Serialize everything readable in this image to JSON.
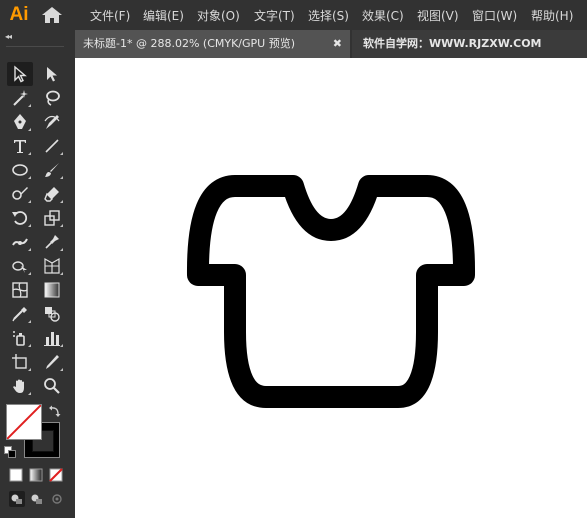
{
  "app": {
    "logo_text": "Ai"
  },
  "menu": {
    "items": [
      {
        "label": "文件(F)"
      },
      {
        "label": "编辑(E)"
      },
      {
        "label": "对象(O)"
      },
      {
        "label": "文字(T)"
      },
      {
        "label": "选择(S)"
      },
      {
        "label": "效果(C)"
      },
      {
        "label": "视图(V)"
      },
      {
        "label": "窗口(W)"
      },
      {
        "label": "帮助(H)"
      }
    ]
  },
  "toolbar": {
    "collapse_label": "◂◂",
    "tools": [
      {
        "icon": "selection-tool-icon"
      },
      {
        "icon": "direct-selection-tool-icon"
      },
      {
        "icon": "magic-wand-tool-icon"
      },
      {
        "icon": "lasso-tool-icon"
      },
      {
        "icon": "pen-tool-icon"
      },
      {
        "icon": "curvature-tool-icon"
      },
      {
        "icon": "type-tool-icon",
        "glyph": "T"
      },
      {
        "icon": "line-segment-tool-icon"
      },
      {
        "icon": "ellipse-tool-icon"
      },
      {
        "icon": "paintbrush-tool-icon"
      },
      {
        "icon": "shaper-tool-icon"
      },
      {
        "icon": "eraser-tool-icon"
      },
      {
        "icon": "rotate-tool-icon"
      },
      {
        "icon": "scale-tool-icon"
      },
      {
        "icon": "width-tool-icon"
      },
      {
        "icon": "puppet-warp-tool-icon"
      },
      {
        "icon": "shape-builder-tool-icon"
      },
      {
        "icon": "perspective-grid-tool-icon"
      },
      {
        "icon": "mesh-tool-icon"
      },
      {
        "icon": "gradient-tool-icon"
      },
      {
        "icon": "eyedropper-tool-icon"
      },
      {
        "icon": "blend-tool-icon"
      },
      {
        "icon": "symbol-sprayer-tool-icon"
      },
      {
        "icon": "column-graph-tool-icon"
      },
      {
        "icon": "artboard-tool-icon"
      },
      {
        "icon": "slice-tool-icon"
      },
      {
        "icon": "hand-tool-icon"
      },
      {
        "icon": "zoom-tool-icon"
      }
    ],
    "fill_color": "#ffffff",
    "stroke_color": "#000000"
  },
  "tabs": [
    {
      "title": "未标题-1* @ 288.02% (CMYK/GPU 预览)",
      "close": "✖"
    },
    {
      "title": "软件自学网：WWW.RJZXW.COM"
    }
  ],
  "colors": {
    "accent": "#ff9a00",
    "ui_bg": "#323232",
    "canvas": "#ffffff",
    "artwork": "#000000"
  },
  "artwork": {
    "icon": "t-shirt-icon"
  }
}
